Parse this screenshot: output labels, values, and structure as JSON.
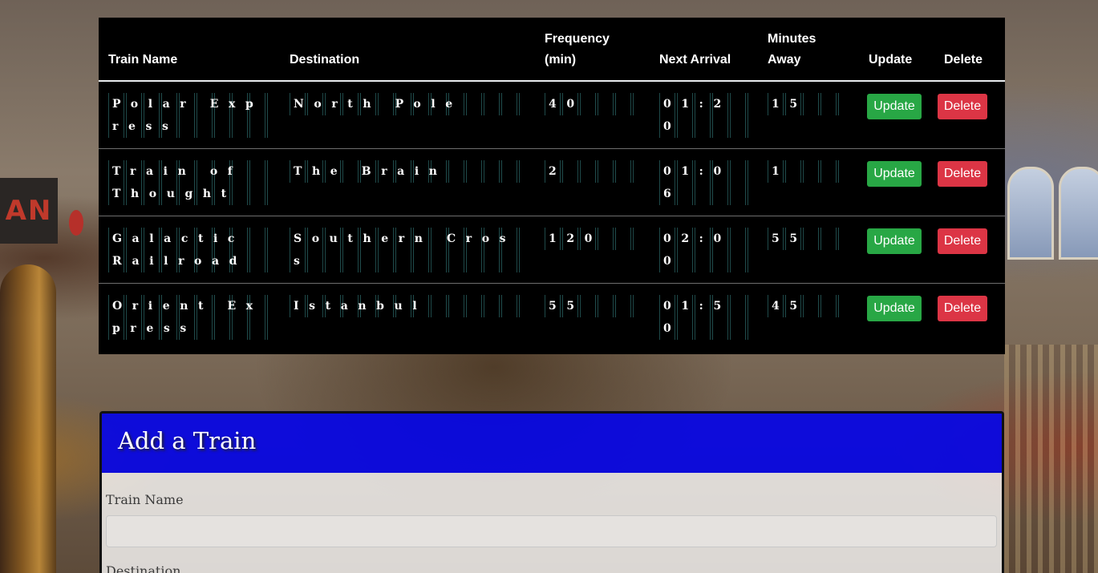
{
  "table": {
    "headers": {
      "train_name": "Train Name",
      "destination": "Destination",
      "frequency_line1": "Frequency",
      "frequency_line2": "(min)",
      "next_arrival": "Next Arrival",
      "minutes_line1": "Minutes",
      "minutes_line2": "Away",
      "update": "Update",
      "delete": "Delete"
    },
    "rows": [
      {
        "name": "Polar Express",
        "destination": "North Pole",
        "frequency": "40",
        "next_arrival": "01:20",
        "minutes_away": "15",
        "update_label": "Update",
        "delete_label": "Delete"
      },
      {
        "name": "Train of Thought",
        "destination": "The Brain",
        "frequency": "2",
        "next_arrival": "01:06",
        "minutes_away": "1",
        "update_label": "Update",
        "delete_label": "Delete"
      },
      {
        "name": "Galactic Railroad",
        "destination": "Southern Cross",
        "frequency": "120",
        "next_arrival": "02:00",
        "minutes_away": "55",
        "update_label": "Update",
        "delete_label": "Delete"
      },
      {
        "name": "Orient Express",
        "destination": "Istanbul",
        "frequency": "55",
        "next_arrival": "01:50",
        "minutes_away": "45",
        "update_label": "Update",
        "delete_label": "Delete"
      }
    ]
  },
  "add_form": {
    "title": "Add a Train",
    "train_name_label": "Train Name",
    "train_name_value": "",
    "destination_label": "Destination"
  },
  "colors": {
    "update_button": "#28a745",
    "delete_button": "#dc3545",
    "card_header": "#0505e6"
  },
  "background": {
    "sign_text": "AN"
  }
}
